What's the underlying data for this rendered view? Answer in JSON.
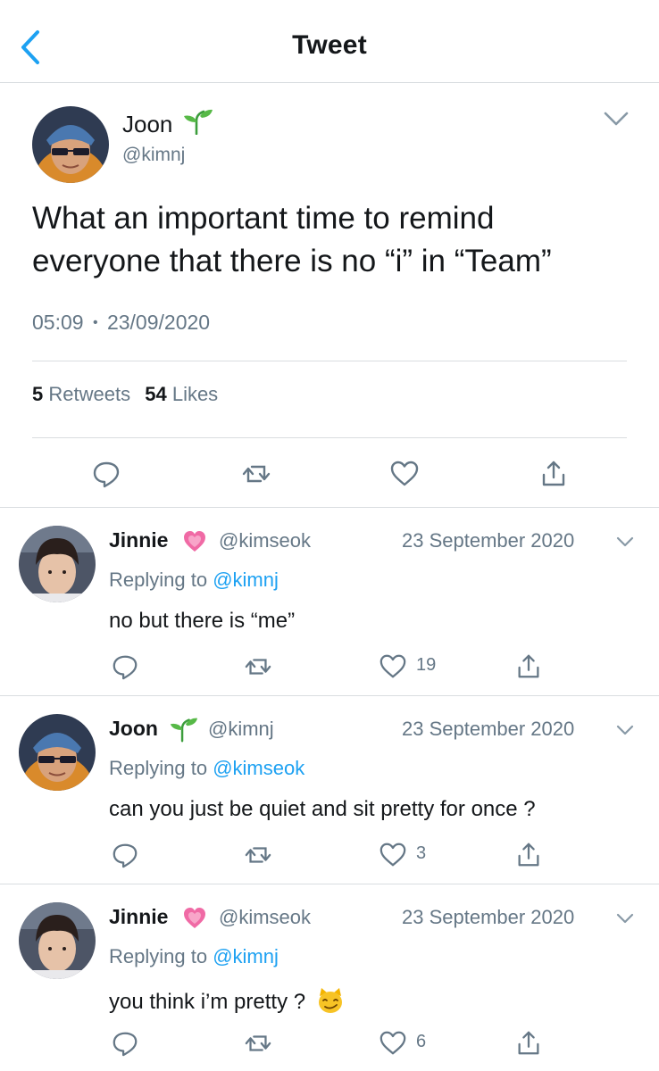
{
  "header": {
    "title": "Tweet"
  },
  "main_tweet": {
    "name": "Joon",
    "name_emoji": "seedling",
    "handle": "@kimnj",
    "text_line1": "What an important time to remind",
    "text_line2": "everyone that there is no “i” in “Team”",
    "time": "05:09",
    "separator": "•",
    "date": "23/09/2020",
    "retweets_count": "5",
    "retweets_label": "Retweets",
    "likes_count": "54",
    "likes_label": "Likes"
  },
  "replies": [
    {
      "name": "Jinnie",
      "name_emoji": "growing-heart",
      "handle": "@kimseok",
      "date": "23 September 2020",
      "replying_prefix": "Replying to",
      "replying_to": "@kimnj",
      "text": "no but there is “me”",
      "likes": "19"
    },
    {
      "name": "Joon",
      "name_emoji": "seedling",
      "handle": "@kimnj",
      "date": "23 September 2020",
      "replying_prefix": "Replying to",
      "replying_to": "@kimseok",
      "text": "can you just be quiet and sit pretty for once ?",
      "likes": "3"
    },
    {
      "name": "Jinnie",
      "name_emoji": "growing-heart",
      "handle": "@kimseok",
      "date": "23 September 2020",
      "replying_prefix": "Replying to",
      "replying_to": "@kimnj",
      "text": "you think i’m pretty ?",
      "text_emoji": "smirking-cat",
      "likes": "6"
    }
  ],
  "colors": {
    "link": "#1da1f2",
    "secondary_text": "#657786",
    "primary_text": "#14171a",
    "divider": "#d9dde0"
  }
}
